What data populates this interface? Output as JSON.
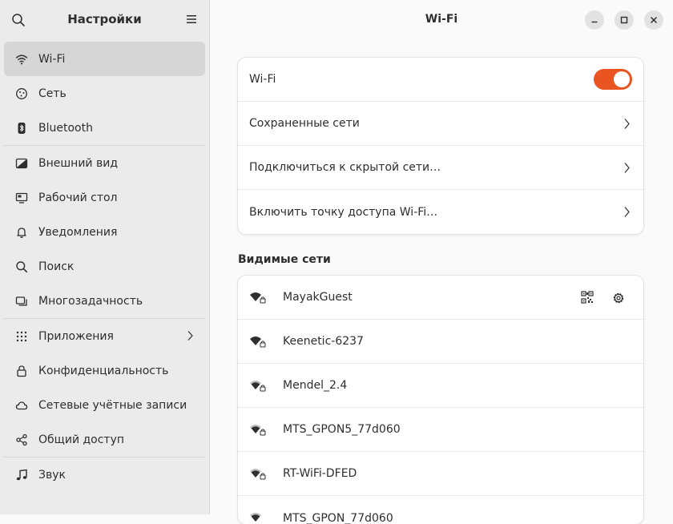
{
  "sidebar": {
    "title": "Настройки",
    "search_icon": "search-icon",
    "menu_icon": "hamburger-menu-icon",
    "groups": [
      [
        {
          "label": "Wi-Fi",
          "icon": "wifi-icon",
          "active": true
        },
        {
          "label": "Сеть",
          "icon": "network-icon"
        },
        {
          "label": "Bluetooth",
          "icon": "bluetooth-icon"
        }
      ],
      [
        {
          "label": "Внешний вид",
          "icon": "appearance-icon"
        },
        {
          "label": "Рабочий стол",
          "icon": "desktop-icon"
        },
        {
          "label": "Уведомления",
          "icon": "bell-icon"
        },
        {
          "label": "Поиск",
          "icon": "search-icon"
        },
        {
          "label": "Многозадачность",
          "icon": "multitasking-icon"
        }
      ],
      [
        {
          "label": "Приложения",
          "icon": "apps-grid-icon",
          "has_chevron": true
        },
        {
          "label": "Конфиденциальность",
          "icon": "lock-icon"
        },
        {
          "label": "Сетевые учётные записи",
          "icon": "cloud-icon"
        },
        {
          "label": "Общий доступ",
          "icon": "share-icon"
        }
      ],
      [
        {
          "label": "Звук",
          "icon": "music-note-icon"
        }
      ]
    ]
  },
  "main": {
    "title": "Wi-Fi",
    "window_controls": [
      "minimize-icon",
      "maximize-icon",
      "close-icon"
    ],
    "wifi_card": {
      "toggle_label": "Wi-Fi",
      "toggle_on": true,
      "rows": [
        "Сохраненные сети",
        "Подключиться к скрытой сети…",
        "Включить точку доступа Wi-Fi…"
      ]
    },
    "visible_networks_title": "Видимые сети",
    "networks": [
      {
        "name": "MayakGuest",
        "connected": true
      },
      {
        "name": "Keenetic-6237"
      },
      {
        "name": "Mendel_2.4"
      },
      {
        "name": "MTS_GPON5_77d060"
      },
      {
        "name": "RT-WiFi-DFED"
      },
      {
        "name": "MTS_GPON_77d060"
      }
    ]
  },
  "colors": {
    "accent": "#e95420",
    "sidebar_bg": "#ebebeb",
    "sidebar_active": "#d6d6d6"
  }
}
